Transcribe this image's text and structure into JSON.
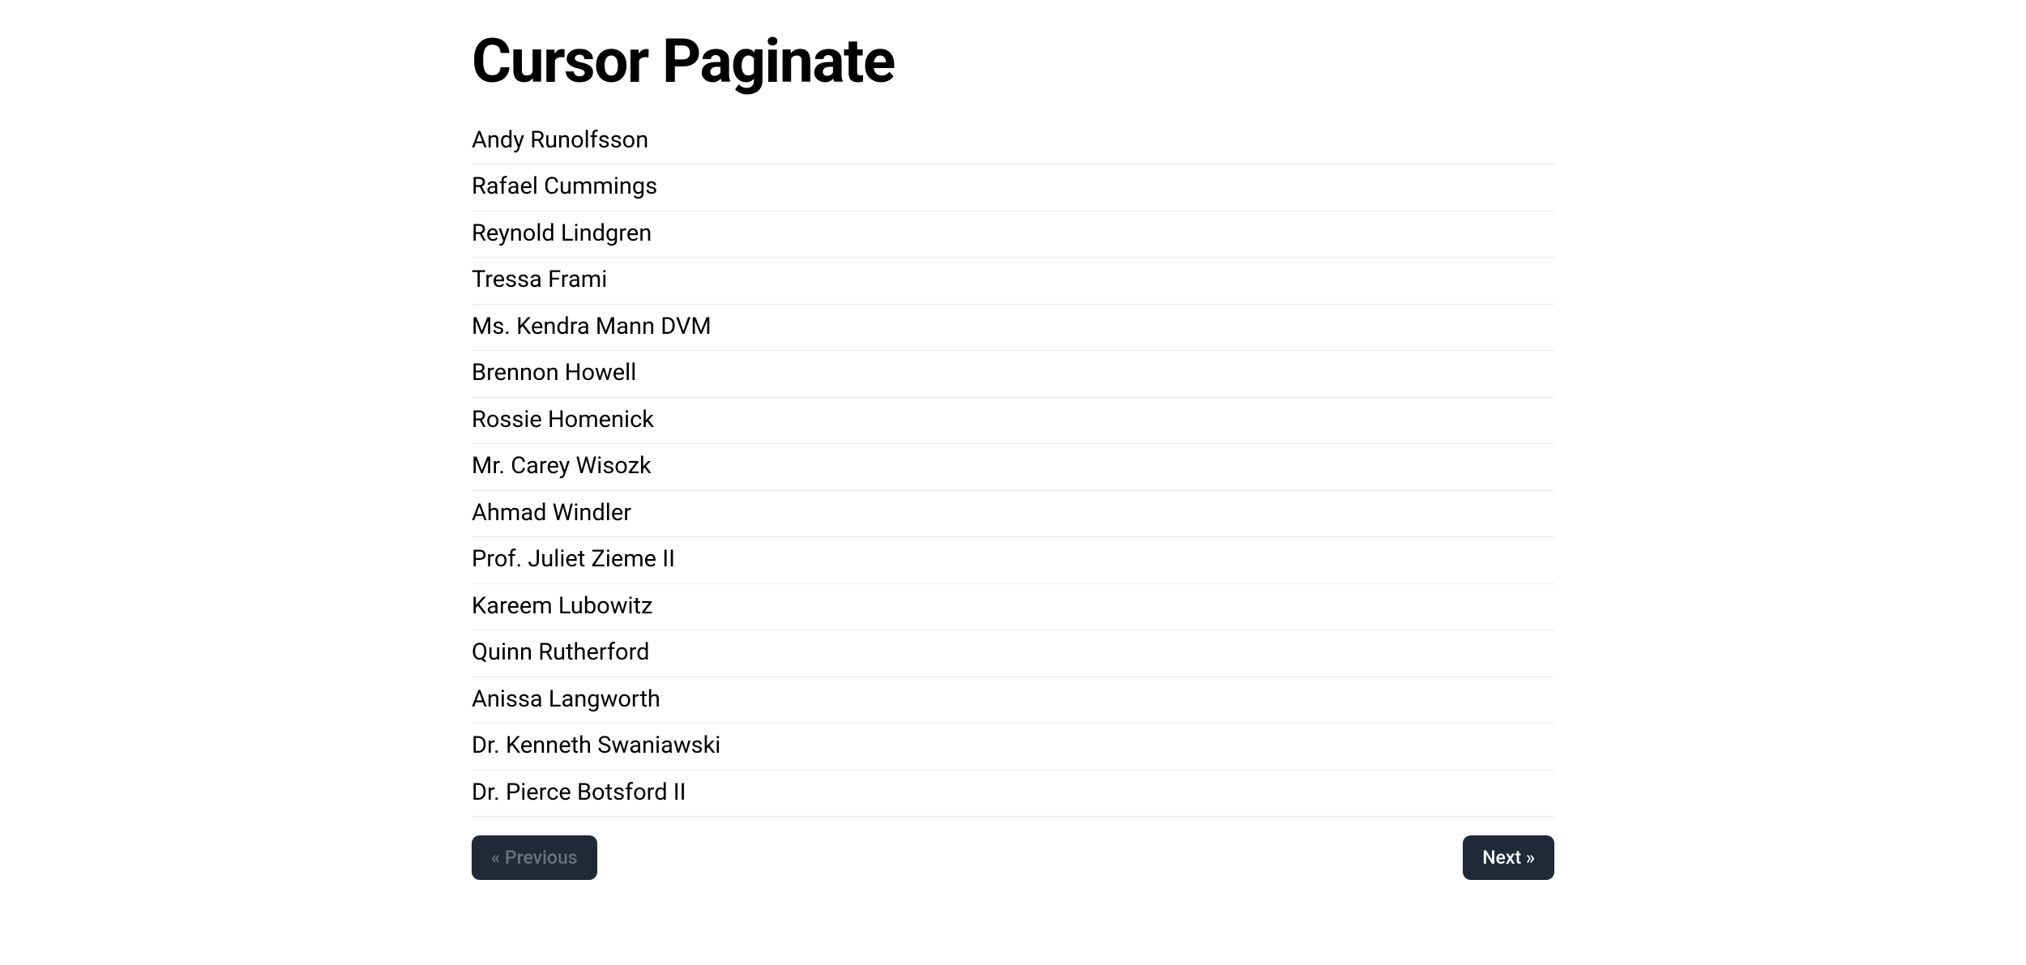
{
  "page": {
    "title": "Cursor Paginate"
  },
  "users": [
    "Andy Runolfsson",
    "Rafael Cummings",
    "Reynold Lindgren",
    "Tressa Frami",
    "Ms. Kendra Mann DVM",
    "Brennon Howell",
    "Rossie Homenick",
    "Mr. Carey Wisozk",
    "Ahmad Windler",
    "Prof. Juliet Zieme II",
    "Kareem Lubowitz",
    "Quinn Rutherford",
    "Anissa Langworth",
    "Dr. Kenneth Swaniawski",
    "Dr. Pierce Botsford II"
  ],
  "pagination": {
    "previous_label": "« Previous",
    "next_label": "Next »",
    "previous_disabled": true,
    "next_disabled": false
  }
}
